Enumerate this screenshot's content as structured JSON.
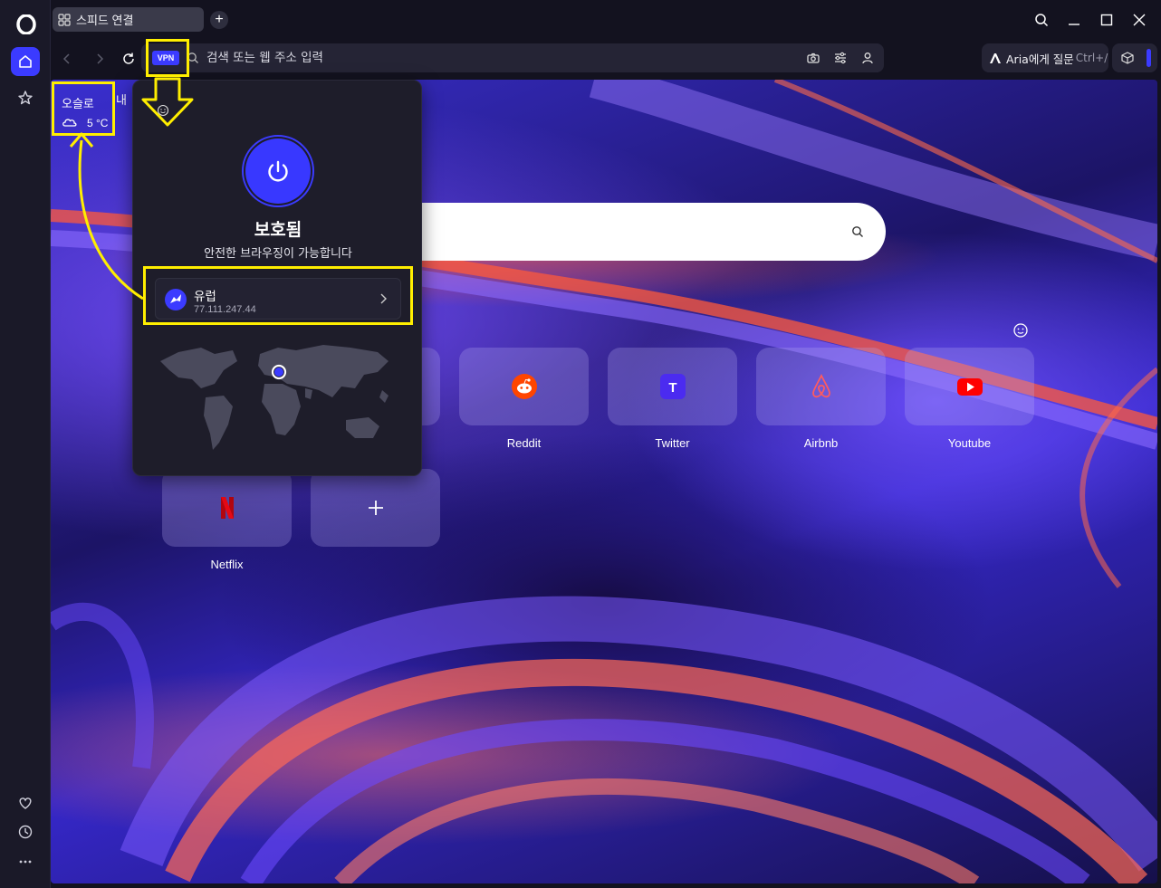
{
  "window": {
    "tab_title": "스피드 연결",
    "new_tab": "+"
  },
  "toolbar": {
    "vpn_badge": "VPN",
    "url_placeholder": "검색 또는 웹 주소 입력",
    "aria_label": "Aria에게 질문",
    "aria_shortcut": "Ctrl+/"
  },
  "weather": {
    "city": "오슬로",
    "temperature": "5 °C",
    "more_label": "내"
  },
  "vpn_popup": {
    "status": "보호됨",
    "description": "안전한 브라우징이 가능합니다",
    "location_name": "유럽",
    "location_ip": "77.111.247.44"
  },
  "speed_dials": [
    {
      "label": "Reddit",
      "icon": "reddit-icon",
      "color": "#ff4500"
    },
    {
      "label": "Twitter",
      "icon": "twitter-t-icon",
      "color": "#3b3bff"
    },
    {
      "label": "Airbnb",
      "icon": "airbnb-icon",
      "color": "#ff5a5f"
    },
    {
      "label": "Youtube",
      "icon": "youtube-icon",
      "color": "#ff0000"
    },
    {
      "label": "Netflix",
      "icon": "netflix-icon",
      "color": "#e50914"
    },
    {
      "label": "",
      "icon": "add-icon",
      "color": "#ffffff"
    }
  ],
  "colors": {
    "accent": "#3b3bff",
    "annotation": "#ffee00"
  }
}
